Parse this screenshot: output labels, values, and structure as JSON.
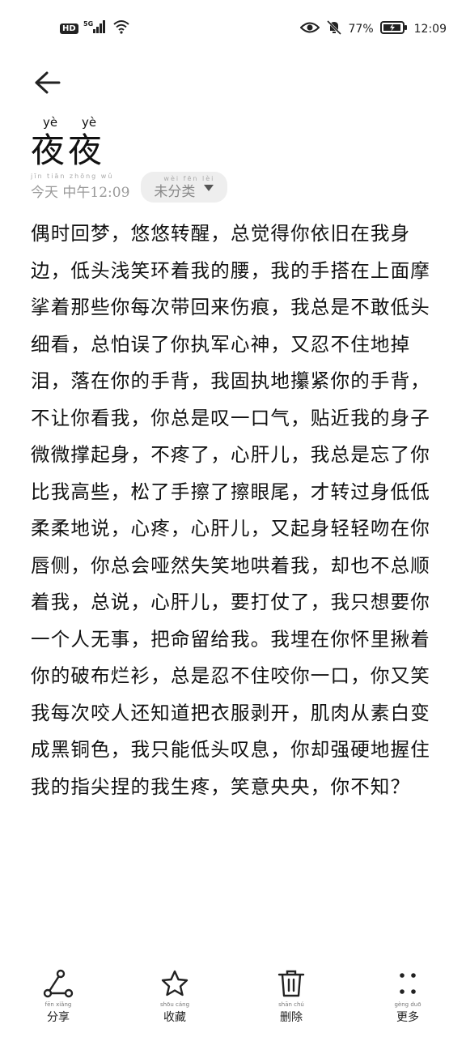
{
  "status_bar": {
    "badge": "HD",
    "network": "5G",
    "battery": "77%",
    "time": "12:09",
    "icons": [
      "signal-icon",
      "wifi-icon",
      "eye-icon",
      "mute-icon",
      "battery-icon"
    ]
  },
  "header": {
    "back_icon": "arrow-left-icon",
    "title_pinyin": [
      "yè",
      "yè"
    ],
    "title": "夜夜",
    "date_pinyin": "jīn tiān zhōng wǔ",
    "date": "今天 中午12:09",
    "category_pinyin": "wèi fēn lèi",
    "category": "未分类"
  },
  "body": {
    "text": "偶时回梦，悠悠转醒，总觉得你依旧在我身边，低头浅笑环着我的腰，我的手搭在上面摩挲着那些你每次带回来伤痕，我总是不敢低头细看，总怕误了你执军心神，又忍不住地掉泪，落在你的手背，我固执地攥紧你的手背，不让你看我，你总是叹一口气，贴近我的身子微微撑起身，不疼了，心肝儿，我总是忘了你比我高些，松了手擦了擦眼尾，才转过身低低柔柔地说，心疼，心肝儿，又起身轻轻吻在你唇侧，你总会哑然失笑地哄着我，却也不总顺着我，总说，心肝儿，要打仗了，我只想要你一个人无事，把命留给我。我埋在你怀里揪着你的破布烂衫，总是忍不住咬你一口，你又笑我每次咬人还知道把衣服剥开，肌肉从素白变成黑铜色，我只能低头叹息，你却强硬地握住我的指尖捏的我生疼，笑意央央，你不知？"
  },
  "toolbar": [
    {
      "icon": "share-icon",
      "pinyin": "fēn xiǎng",
      "label": "分享"
    },
    {
      "icon": "star-icon",
      "pinyin": "shōu cáng",
      "label": "收藏"
    },
    {
      "icon": "trash-icon",
      "pinyin": "shān chú",
      "label": "删除"
    },
    {
      "icon": "more-icon",
      "pinyin": "gèng duō",
      "label": "更多"
    }
  ]
}
